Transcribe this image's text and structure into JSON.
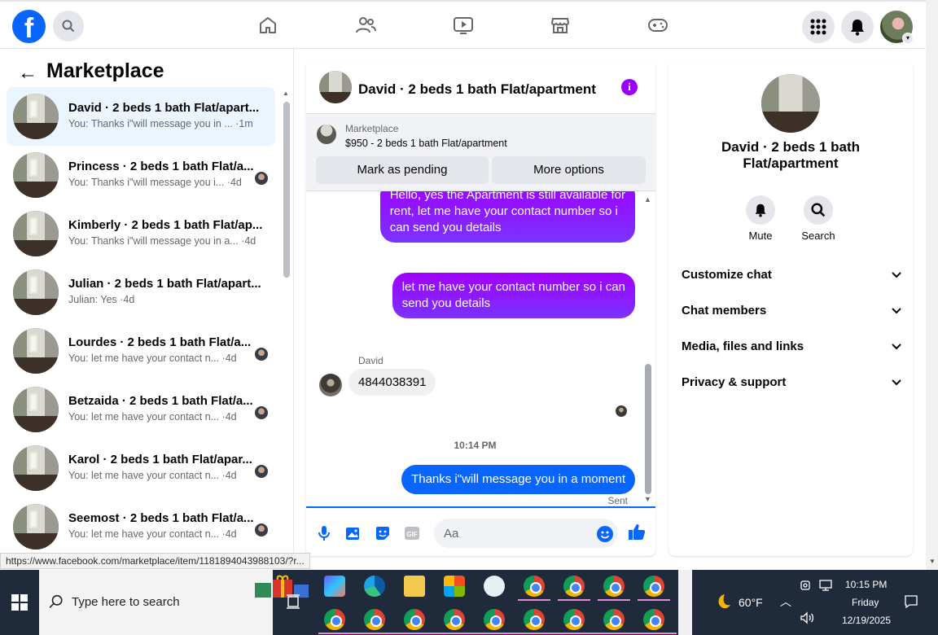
{
  "topnav": {
    "logo": "f",
    "icons": [
      "home-icon",
      "friends-icon",
      "video-icon",
      "marketplace-icon",
      "gaming-icon"
    ],
    "right_icons": [
      "menu-grid-icon",
      "notifications-icon",
      "profile-avatar"
    ]
  },
  "marketplace": {
    "back_glyph": "←",
    "title": "Marketplace",
    "conversations": [
      {
        "name": "David · 2 beds 1 bath Flat/apart...",
        "preview": "You: Thanks i\"will message you in ... ·1m",
        "active": true,
        "seen": false
      },
      {
        "name": "Princess · 2 beds 1 bath Flat/a...",
        "preview": "You: Thanks i\"will message you i... ·4d",
        "active": false,
        "seen": true
      },
      {
        "name": "Kimberly · 2 beds 1 bath Flat/ap...",
        "preview": "You: Thanks i\"will message you in a... ·4d",
        "active": false,
        "seen": false
      },
      {
        "name": "Julian · 2 beds 1 bath Flat/apart...",
        "preview": "Julian: Yes ·4d",
        "active": false,
        "seen": false
      },
      {
        "name": "Lourdes · 2 beds 1 bath Flat/a...",
        "preview": "You: let me have your contact n... ·4d",
        "active": false,
        "seen": true
      },
      {
        "name": "Betzaida · 2 beds 1 bath Flat/a...",
        "preview": "You: let me have your contact n... ·4d",
        "active": false,
        "seen": true
      },
      {
        "name": "Karol · 2 beds 1 bath Flat/apar...",
        "preview": "You: let me have your contact n... ·4d",
        "active": false,
        "seen": true
      },
      {
        "name": "Seemost · 2 beds 1 bath Flat/a...",
        "preview": "You: let me have your contact n... ·4d",
        "active": false,
        "seen": true
      }
    ]
  },
  "chat": {
    "title": "David · 2 beds 1 bath Flat/apartment",
    "info_glyph": "i",
    "listing": {
      "label": "Marketplace",
      "price_title": "$950 - 2 beds 1 bath Flat/apartment",
      "mark_pending": "Mark as pending",
      "more_options": "More options"
    },
    "messages": {
      "out1": "Hello, yes the Apartment is still available for\nrent, let me have your contact number so i\ncan send you details",
      "out2": "let me have your contact number so i can\nsend you details",
      "sender": "David",
      "in1": "4844038391",
      "time": "10:14 PM",
      "out3": "Thanks i\"will message you in a moment",
      "status": "Sent"
    },
    "composer_placeholder": "Aa"
  },
  "details": {
    "name": "David · 2 beds 1 bath Flat/apartment",
    "mute_label": "Mute",
    "search_label": "Search",
    "sections": [
      "Customize chat",
      "Chat members",
      "Media, files and links",
      "Privacy & support"
    ]
  },
  "status_url": "https://www.facebook.com/marketplace/item/1181894043988103/?r...",
  "taskbar": {
    "search_placeholder": "Type here to search",
    "weather": "60°F",
    "time": "10:15 PM",
    "day": "Friday",
    "date": "12/19/2025"
  },
  "colors": {
    "brand": "#0866ff",
    "messenger_purple": "#a100ff",
    "active_row": "#ebf5ff"
  }
}
